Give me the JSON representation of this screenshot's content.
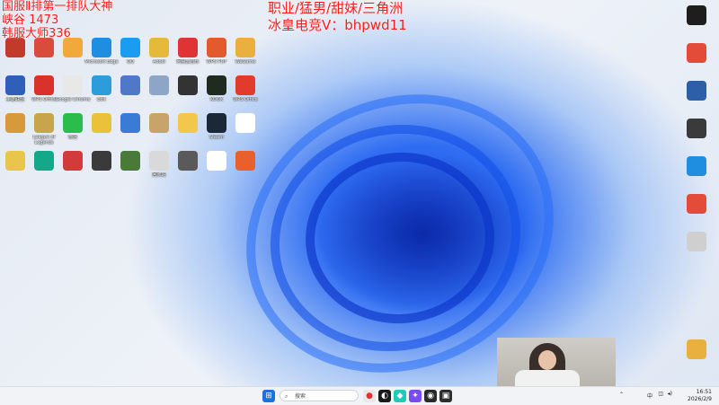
{
  "overlay": {
    "left_line1": "国服Ⅱ排第一排队大神",
    "left_line2": "峡谷 1473",
    "left_line3": "韩服大师336",
    "right_line1": "职业/猛男/甜妹/三角洲",
    "right_line2": "冰皇电竞V：bhpwd11"
  },
  "taskbar": {
    "search_placeholder": "搜索",
    "time": "16:51",
    "date": "2026/2/9",
    "lang": "中"
  },
  "icons": [
    {
      "label": "",
      "color": "#c23a2a"
    },
    {
      "label": "",
      "color": "#d94b3a"
    },
    {
      "label": "",
      "color": "#f2a93b"
    },
    {
      "label": "Microsoft Edge",
      "color": "#1f8de0"
    },
    {
      "label": "QQ",
      "color": "#1a9cf0"
    },
    {
      "label": "Aobel",
      "color": "#e7b93a"
    },
    {
      "label": "网易云音乐",
      "color": "#e03434"
    },
    {
      "label": "WPS PDF",
      "color": "#e25a2d"
    },
    {
      "label": "WeGame",
      "color": "#e9b040"
    },
    {
      "label": "英雄联盟",
      "color": "#2f5fb8"
    },
    {
      "label": "WPS Office",
      "color": "#d8322b"
    },
    {
      "label": "Google Chrome",
      "color": "#e8e8e8"
    },
    {
      "label": "Edit",
      "color": "#2d9cdb"
    },
    {
      "label": "",
      "color": "#5078c8"
    },
    {
      "label": "",
      "color": "#8da6c8"
    },
    {
      "label": "",
      "color": "#333333"
    },
    {
      "label": "KOOK",
      "color": "#1f2b1f"
    },
    {
      "label": "WPS Office",
      "color": "#e03b2c"
    },
    {
      "label": "",
      "color": "#d69a3a"
    },
    {
      "label": "League of Legends",
      "color": "#c8a44a"
    },
    {
      "label": "微信",
      "color": "#2bbd4b"
    },
    {
      "label": "",
      "color": "#e9c23a"
    },
    {
      "label": "",
      "color": "#3a7bd5"
    },
    {
      "label": "",
      "color": "#c9a46a"
    },
    {
      "label": "",
      "color": "#f3c74c"
    },
    {
      "label": "Steam",
      "color": "#1b2838"
    },
    {
      "label": "",
      "color": "#ffffff"
    },
    {
      "label": "",
      "color": "#e8c64c"
    },
    {
      "label": "",
      "color": "#13a88a"
    },
    {
      "label": "",
      "color": "#d23b3b"
    },
    {
      "label": "",
      "color": "#3a3a3a"
    },
    {
      "label": "",
      "color": "#4a7a3a"
    },
    {
      "label": "回收站",
      "color": "#d9d9d9"
    },
    {
      "label": "",
      "color": "#5a5a5a"
    },
    {
      "label": "",
      "color": "#ffffff"
    },
    {
      "label": "",
      "color": "#e8602b"
    }
  ]
}
